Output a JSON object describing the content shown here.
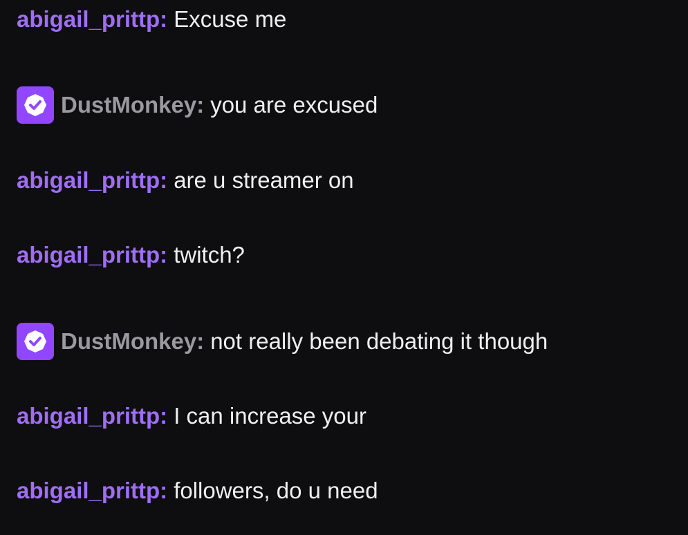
{
  "colors": {
    "background": "#0e0e10",
    "text": "#efeff1",
    "user_purple": "#9f6ef5",
    "user_gray": "#9a9a9e",
    "badge_purple": "#9147ff"
  },
  "messages": [
    {
      "user": "abigail_prittp:",
      "text": "Excuse me",
      "badge": null
    },
    {
      "user": "DustMonkey:",
      "text": "you are excused",
      "badge": "verified-icon"
    },
    {
      "user": "abigail_prittp:",
      "text": "are u streamer on",
      "badge": null
    },
    {
      "user": "abigail_prittp:",
      "text": "twitch?",
      "badge": null
    },
    {
      "user": "DustMonkey:",
      "text": "not really been debating it though",
      "badge": "verified-icon"
    },
    {
      "user": "abigail_prittp:",
      "text": "I can increase your",
      "badge": null
    },
    {
      "user": "abigail_prittp:",
      "text": "followers, do u need",
      "badge": null
    }
  ]
}
